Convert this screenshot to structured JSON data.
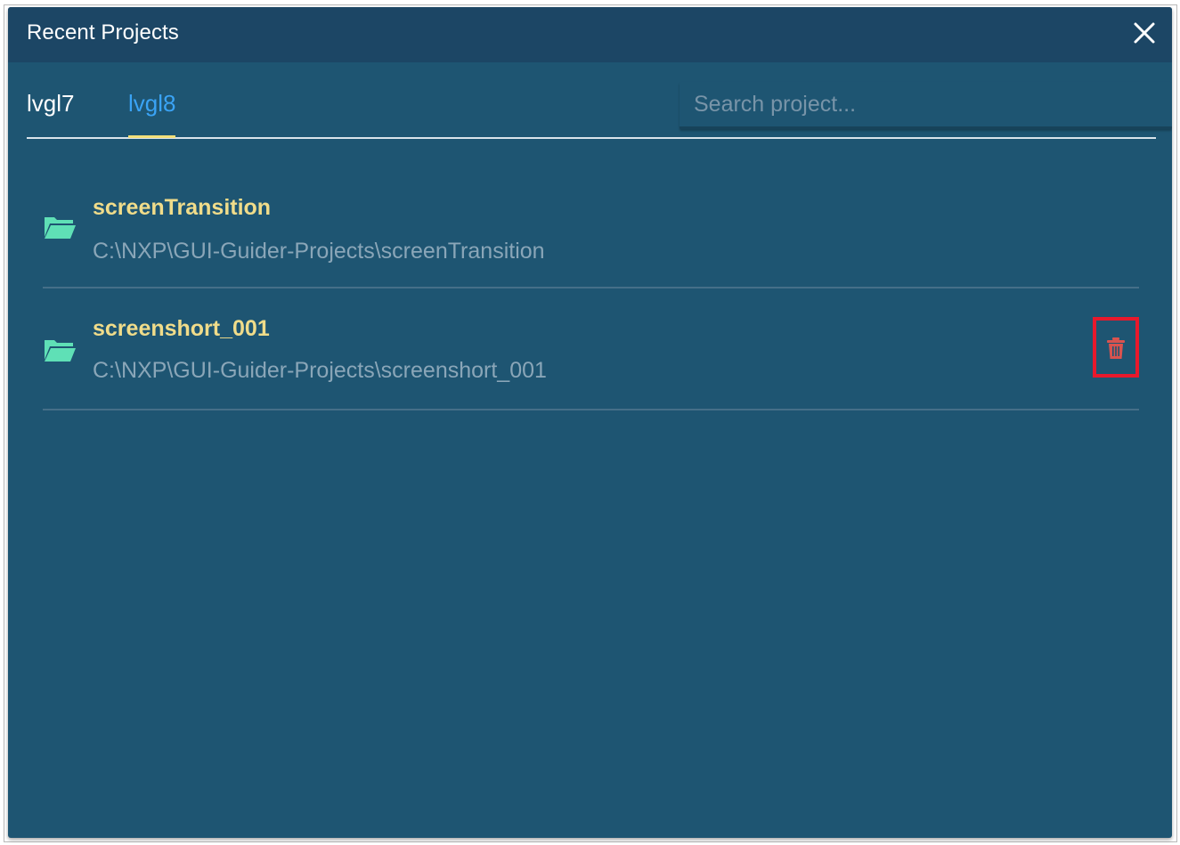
{
  "window": {
    "title": "Recent Projects",
    "close_icon": "close-icon"
  },
  "tabs": [
    {
      "label": "lvgl7",
      "active": false
    },
    {
      "label": "lvgl8",
      "active": true
    }
  ],
  "search": {
    "value": "",
    "placeholder": "Search project..."
  },
  "projects": [
    {
      "name": "screenTransition",
      "path": "C:\\NXP\\GUI-Guider-Projects\\screenTransition",
      "icon": "folder-open-icon"
    },
    {
      "name": "screenshort_001",
      "path": "C:\\NXP\\GUI-Guider-Projects\\screenshort_001",
      "icon": "folder-open-icon",
      "action_icon": "trash-icon"
    }
  ],
  "colors": {
    "dialog_bg": "#1e5572",
    "titlebar_bg": "#1c4665",
    "active_tab": "#3aa3f5",
    "tab_underline": "#f2df7a",
    "project_name": "#f0dc8a",
    "project_path": "#8aa6b8",
    "folder_icon": "#5fe0b6",
    "delete_icon": "#d9534f",
    "highlight_box": "#e8192c"
  }
}
